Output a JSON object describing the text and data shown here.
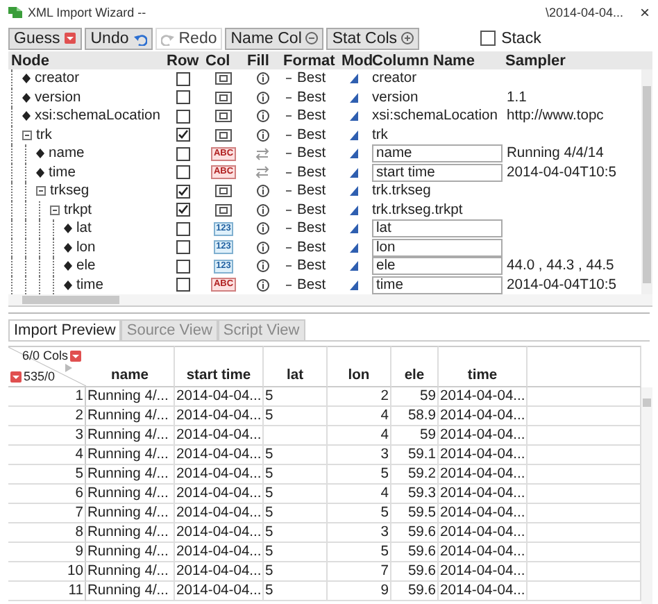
{
  "window": {
    "title": "XML Import Wizard --",
    "path": "\\2014-04-04...",
    "close": "×"
  },
  "toolbar": {
    "buttons": [
      {
        "label": "Guess",
        "kind": "dropdown",
        "disabled": false
      },
      {
        "label": "Undo",
        "kind": "undo",
        "disabled": false
      },
      {
        "label": "Redo",
        "kind": "redo",
        "disabled": true
      },
      {
        "label": "Name Col",
        "kind": "minus",
        "disabled": false
      },
      {
        "label": "Stat Cols",
        "kind": "plus",
        "disabled": false
      }
    ],
    "stack": {
      "label": "Stack",
      "checked": false
    }
  },
  "tree": {
    "columns": [
      "Node",
      "Row",
      "Col",
      "Fill",
      "Format",
      "Mod",
      "Column Name",
      "Sampler"
    ],
    "nodes": [
      {
        "label": "creator",
        "kind": "attribute",
        "row": false,
        "col": {
          "kind": "table"
        },
        "fill": {
          "kind": "info"
        },
        "format": "Best",
        "column_name": "creator",
        "editable": false
      },
      {
        "label": "version",
        "kind": "attribute",
        "row": false,
        "col": {
          "kind": "table"
        },
        "fill": {
          "kind": "info"
        },
        "format": "Best",
        "column_name": "version",
        "editable": false,
        "sampler": "1.1"
      },
      {
        "label": "xsi:schemaLocation",
        "kind": "attribute",
        "row": false,
        "col": {
          "kind": "table"
        },
        "fill": {
          "kind": "info"
        },
        "format": "Best",
        "column_name": "xsi:schemaLocation",
        "editable": false,
        "sampler": "http://www.topc"
      },
      {
        "label": "trk",
        "kind": "element",
        "row": true,
        "col": {
          "kind": "table"
        },
        "fill": {
          "kind": "info"
        },
        "format": "Best",
        "column_name": "trk",
        "editable": false,
        "children": [
          {
            "label": "name",
            "kind": "attribute",
            "row": false,
            "col": {
              "kind": "character",
              "label": "ABC"
            },
            "fill": {
              "kind": "swap"
            },
            "format": "Best",
            "column_name": "name",
            "editable": true,
            "sampler": "Running 4/4/14"
          },
          {
            "label": "time",
            "kind": "attribute",
            "row": false,
            "col": {
              "kind": "character",
              "label": "ABC"
            },
            "fill": {
              "kind": "swap"
            },
            "format": "Best",
            "column_name": "start time",
            "editable": true,
            "sampler": "2014-04-04T10:5"
          },
          {
            "label": "trkseg",
            "kind": "element",
            "row": true,
            "col": {
              "kind": "table"
            },
            "fill": {
              "kind": "info"
            },
            "format": "Best",
            "column_name": "trk.trkseg",
            "editable": false,
            "children": [
              {
                "label": "trkpt",
                "kind": "element",
                "row": true,
                "col": {
                  "kind": "table"
                },
                "fill": {
                  "kind": "info"
                },
                "format": "Best",
                "column_name": "trk.trkseg.trkpt",
                "editable": false,
                "children": [
                  {
                    "label": "lat",
                    "kind": "attribute",
                    "row": false,
                    "col": {
                      "kind": "numeric",
                      "label": "123"
                    },
                    "fill": {
                      "kind": "info"
                    },
                    "format": "Best",
                    "column_name": "lat",
                    "editable": true
                  },
                  {
                    "label": "lon",
                    "kind": "attribute",
                    "row": false,
                    "col": {
                      "kind": "numeric",
                      "label": "123"
                    },
                    "fill": {
                      "kind": "info"
                    },
                    "format": "Best",
                    "column_name": "lon",
                    "editable": true
                  },
                  {
                    "label": "ele",
                    "kind": "attribute",
                    "row": false,
                    "col": {
                      "kind": "numeric",
                      "label": "123"
                    },
                    "fill": {
                      "kind": "info"
                    },
                    "format": "Best",
                    "column_name": "ele",
                    "editable": true,
                    "sampler": "44.0 , 44.3 , 44.5"
                  },
                  {
                    "label": "time",
                    "kind": "attribute",
                    "row": false,
                    "col": {
                      "kind": "character",
                      "label": "ABC"
                    },
                    "fill": {
                      "kind": "info"
                    },
                    "format": "Best",
                    "column_name": "time",
                    "editable": true,
                    "sampler": "2014-04-04T10:5"
                  }
                ]
              }
            ]
          }
        ]
      }
    ]
  },
  "tabs": [
    {
      "label": "Import Preview",
      "selected": true
    },
    {
      "label": "Source View",
      "selected": false
    },
    {
      "label": "Script View",
      "selected": false
    }
  ],
  "preview": {
    "cols_count": "6/0 Cols",
    "rows_count": "535/0",
    "columns": [
      "",
      "name",
      "start time",
      "lat",
      "lon",
      "ele",
      "time"
    ],
    "rows": [
      [
        "1",
        "Running 4/...",
        "2014-04-04...",
        "5",
        "2",
        "59",
        "2014-04-04..."
      ],
      [
        "2",
        "Running 4/...",
        "2014-04-04...",
        "5",
        "4",
        "58.9",
        "2014-04-04..."
      ],
      [
        "3",
        "Running 4/...",
        "2014-04-04...",
        "",
        "4",
        "59",
        "2014-04-04..."
      ],
      [
        "4",
        "Running 4/...",
        "2014-04-04...",
        "5",
        "3",
        "59.1",
        "2014-04-04..."
      ],
      [
        "5",
        "Running 4/...",
        "2014-04-04...",
        "5",
        "5",
        "59.2",
        "2014-04-04..."
      ],
      [
        "6",
        "Running 4/...",
        "2014-04-04...",
        "5",
        "4",
        "59.3",
        "2014-04-04..."
      ],
      [
        "7",
        "Running 4/...",
        "2014-04-04...",
        "5",
        "5",
        "59.5",
        "2014-04-04..."
      ],
      [
        "8",
        "Running 4/...",
        "2014-04-04...",
        "5",
        "3",
        "59.6",
        "2014-04-04..."
      ],
      [
        "9",
        "Running 4/...",
        "2014-04-04...",
        "5",
        "5",
        "59.6",
        "2014-04-04..."
      ],
      [
        "10",
        "Running 4/...",
        "2014-04-04...",
        "5",
        "7",
        "59.6",
        "2014-04-04..."
      ],
      [
        "11",
        "Running 4/...",
        "2014-04-04...",
        "5",
        "9",
        "59.6",
        "2014-04-04..."
      ]
    ]
  }
}
